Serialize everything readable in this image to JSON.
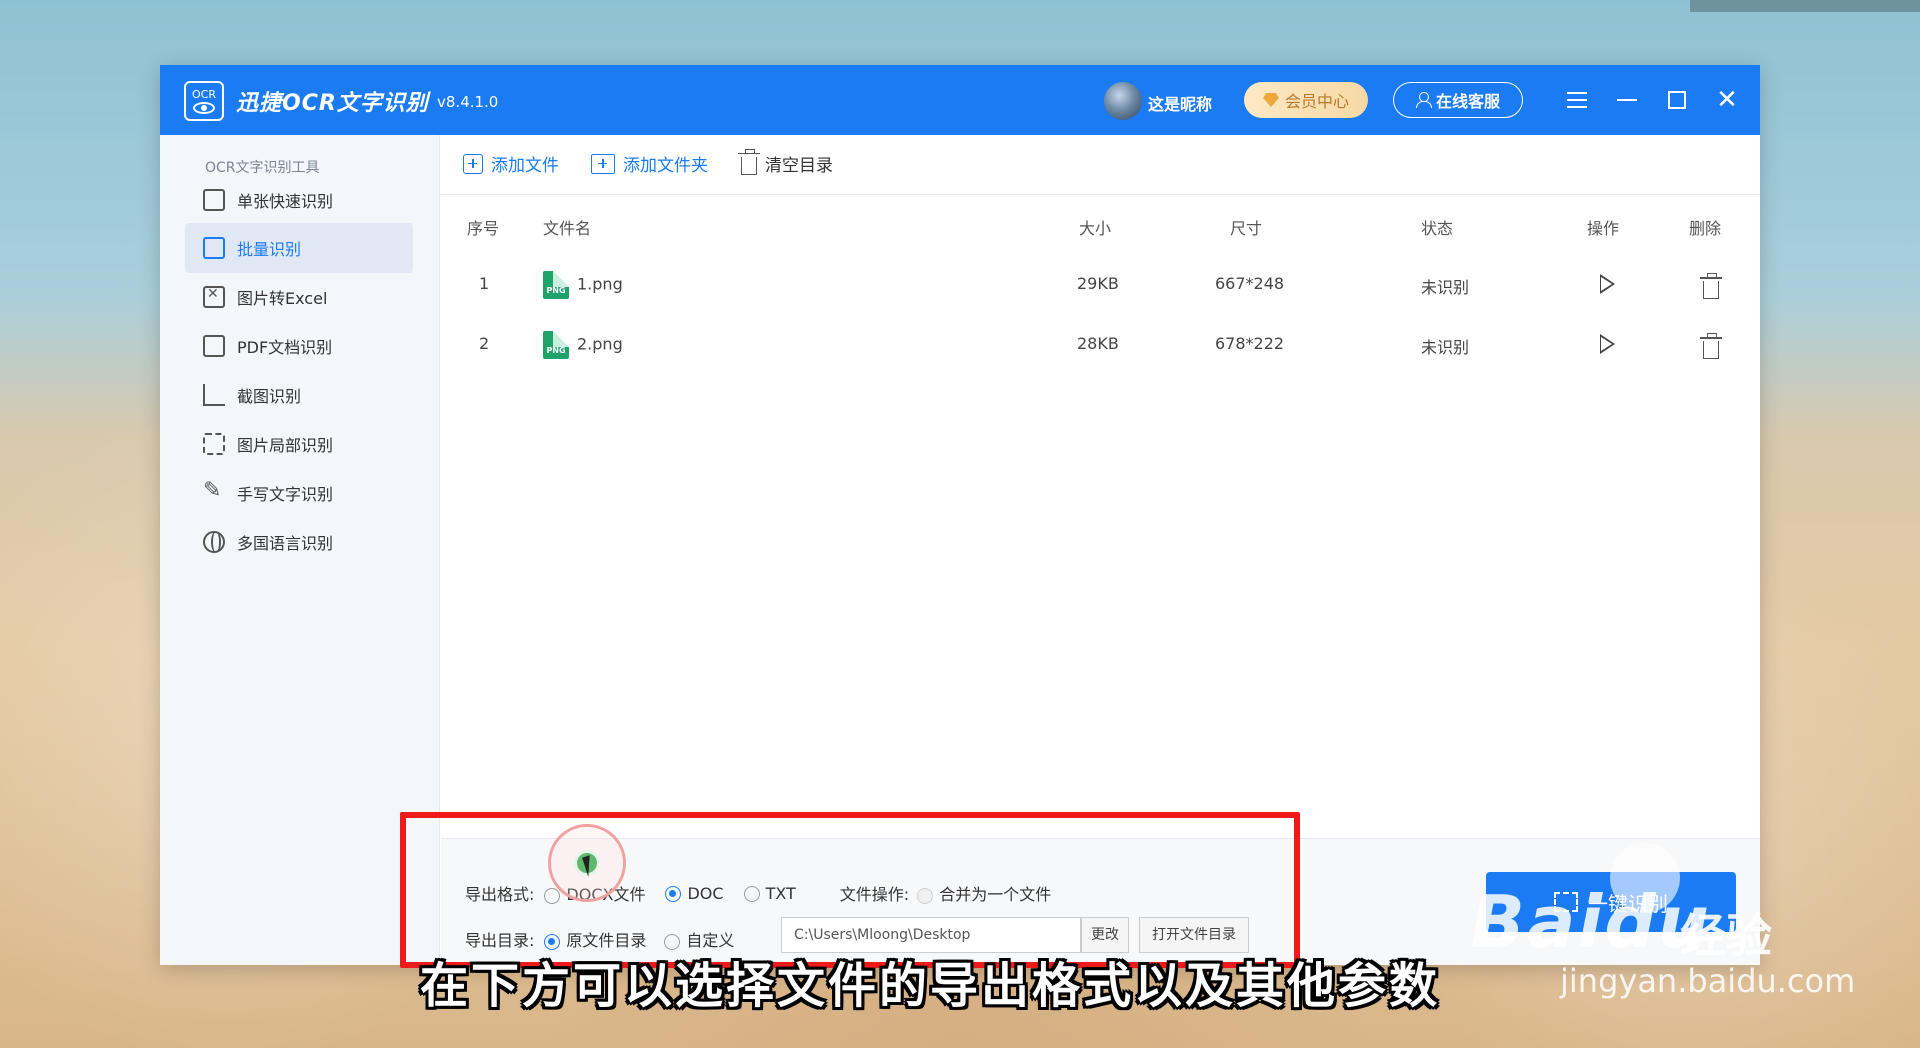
{
  "window": {
    "logo_text": "OCR",
    "app_title": "迅捷OCR文字识别",
    "version": "v8.4.1.0",
    "username": "这是昵称",
    "vip_label": "会员中心",
    "service_label": "在线客服"
  },
  "sidebar": {
    "section_title": "OCR文字识别工具",
    "items": [
      {
        "label": "单张快速识别",
        "icon": "image-scan-icon"
      },
      {
        "label": "批量识别",
        "icon": "batch-icon",
        "active": true
      },
      {
        "label": "图片转Excel",
        "icon": "excel-icon"
      },
      {
        "label": "PDF文档识别",
        "icon": "pdf-icon"
      },
      {
        "label": "截图识别",
        "icon": "crop-icon"
      },
      {
        "label": "图片局部识别",
        "icon": "partial-scan-icon"
      },
      {
        "label": "手写文字识别",
        "icon": "pen-icon"
      },
      {
        "label": "多国语言识别",
        "icon": "globe-icon"
      }
    ]
  },
  "toolbar": {
    "add_file": "添加文件",
    "add_folder": "添加文件夹",
    "clear_list": "清空目录"
  },
  "table": {
    "headers": {
      "index": "序号",
      "filename": "文件名",
      "size": "大小",
      "dimensions": "尺寸",
      "status": "状态",
      "action": "操作",
      "delete": "删除"
    },
    "rows": [
      {
        "index": "1",
        "filename": "1.png",
        "size": "29KB",
        "dimensions": "667*248",
        "status": "未识别"
      },
      {
        "index": "2",
        "filename": "2.png",
        "size": "28KB",
        "dimensions": "678*222",
        "status": "未识别"
      }
    ],
    "file_badge": "PNG"
  },
  "bottom": {
    "format_label": "导出格式:",
    "format_options": [
      "DOCX文件",
      "DOC",
      "TXT"
    ],
    "format_selected": "DOC",
    "file_op_label": "文件操作:",
    "merge_label": "合并为一个文件",
    "dir_label": "导出目录:",
    "dir_options": [
      "原文件目录",
      "自定义"
    ],
    "path_value": "C:\\Users\\Mloong\\Desktop",
    "change_label": "更改",
    "open_dir_label": "打开文件目录",
    "start_label": "一键识别"
  },
  "overlay": {
    "subtitle": "在下方可以选择文件的导出格式以及其他参数",
    "watermark_brand": "Baidu",
    "watermark_product": "经验",
    "watermark_url": "jingyan.baidu.com"
  },
  "colors": {
    "primary": "#1a7bf3",
    "highlight": "#ef1b1b",
    "png_badge": "#1fa36b",
    "vip_gold": "#f0a73a"
  }
}
